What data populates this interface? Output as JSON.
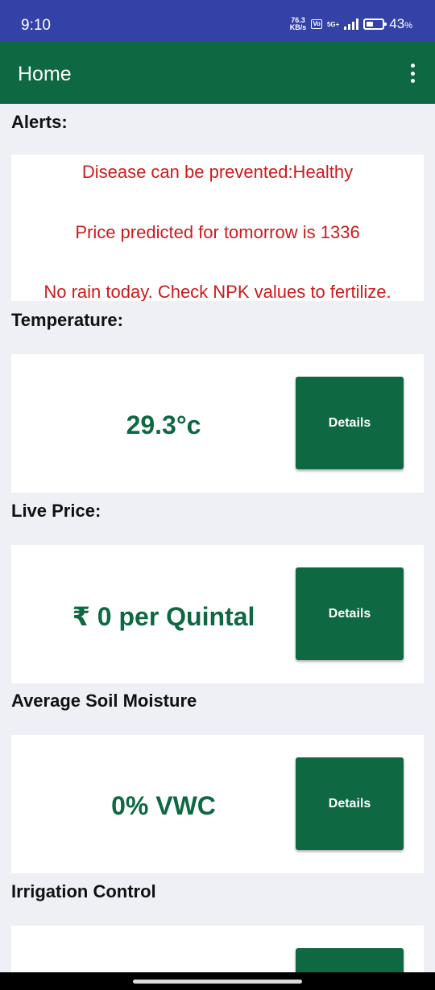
{
  "status_bar": {
    "time": "9:10",
    "speed_value": "76.3",
    "speed_unit": "KB/s",
    "volte": "Vo",
    "network": "5G+",
    "battery_percent": "43",
    "battery_unit": "%",
    "battery_level": 0.43
  },
  "app_bar": {
    "title": "Home",
    "menu_icon": "more-vert-icon"
  },
  "alerts": {
    "title": "Alerts:",
    "items": [
      "Disease can be prevented:Healthy",
      "Price predicted for tomorrow is 1336",
      "No rain today. Check NPK values to fertilize."
    ]
  },
  "temperature": {
    "title": "Temperature:",
    "value": "29.3°c",
    "button_label": "Details"
  },
  "live_price": {
    "title": "Live Price:",
    "value": "₹ 0 per Quintal",
    "button_label": "Details"
  },
  "soil_moisture": {
    "title": "Average Soil Moisture",
    "value": "0% VWC",
    "button_label": "Details"
  },
  "irrigation": {
    "title": "Irrigation Control"
  },
  "colors": {
    "status_bar": "#3442a8",
    "primary": "#0e6841",
    "alert_text": "#cc1b1b",
    "background": "#eef0f5"
  }
}
